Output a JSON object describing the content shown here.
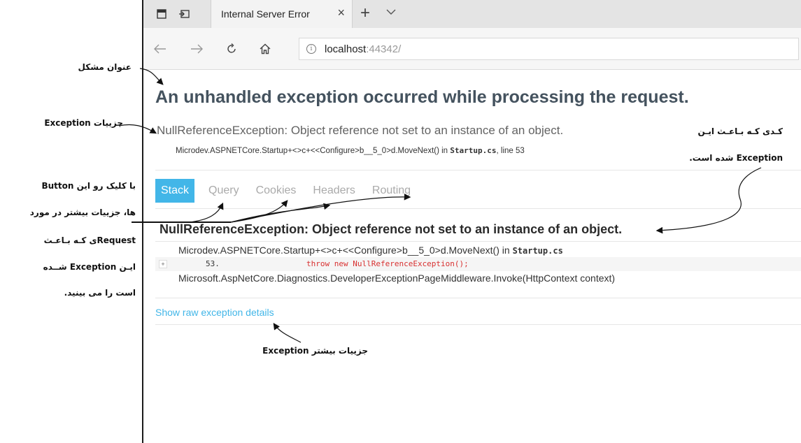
{
  "browser": {
    "tab_title": "Internal Server Error",
    "url_host": "localhost",
    "url_port": ":44342/"
  },
  "page": {
    "title": "An unhandled exception occurred while processing the request.",
    "exception_header": "NullReferenceException: Object reference not set to an instance of an object.",
    "location_prefix": "Microdev.ASPNETCore.Startup+<>c+<<Configure>b__5_0>d.MoveNext() in ",
    "location_file": "Startup.cs",
    "location_suffix": ", line 53",
    "tabs": [
      "Stack",
      "Query",
      "Cookies",
      "Headers",
      "Routing"
    ],
    "stack_title": "NullReferenceException: Object reference not set to an instance of an object.",
    "frame1_prefix": "Microdev.ASPNETCore.Startup+<>c+<<Configure>b__5_0>d.MoveNext() in ",
    "frame1_file": "Startup.cs",
    "line_number": "53.",
    "line_code": "throw new NullReferenceException();",
    "frame2": "Microsoft.AspNetCore.Diagnostics.DeveloperExceptionPageMiddleware.Invoke(HttpContext context)",
    "raw_link": "Show raw exception details"
  },
  "annotations": {
    "title_note": "عنوان مشکل",
    "details_note": "جزییات Exception",
    "code_note_1": "کـدی کـه بـاعـث ایـن",
    "code_note_2": "Exception شده است.",
    "buttons_note_1": "با کلیک رو این Button",
    "buttons_note_2": "ها، جزییات بیشتر در مورد",
    "buttons_note_3": "Requestی کـه بـاعـث",
    "buttons_note_4": "ایـن Exception شــده",
    "buttons_note_5": "است را می بینید.",
    "more_note": "جزییات بیشتر Exception"
  },
  "colors": {
    "accent": "#42b6e8",
    "title": "#44525e",
    "code_red": "#d83030"
  },
  "icons": {
    "tab_preview": "tab-preview-icon",
    "set_aside": "set-aside-tabs-icon",
    "close": "close-icon",
    "new_tab": "plus-icon",
    "tab_menu": "chevron-down-icon",
    "back": "back-arrow-icon",
    "forward": "forward-arrow-icon",
    "refresh": "refresh-icon",
    "home": "home-icon",
    "info": "info-icon"
  }
}
